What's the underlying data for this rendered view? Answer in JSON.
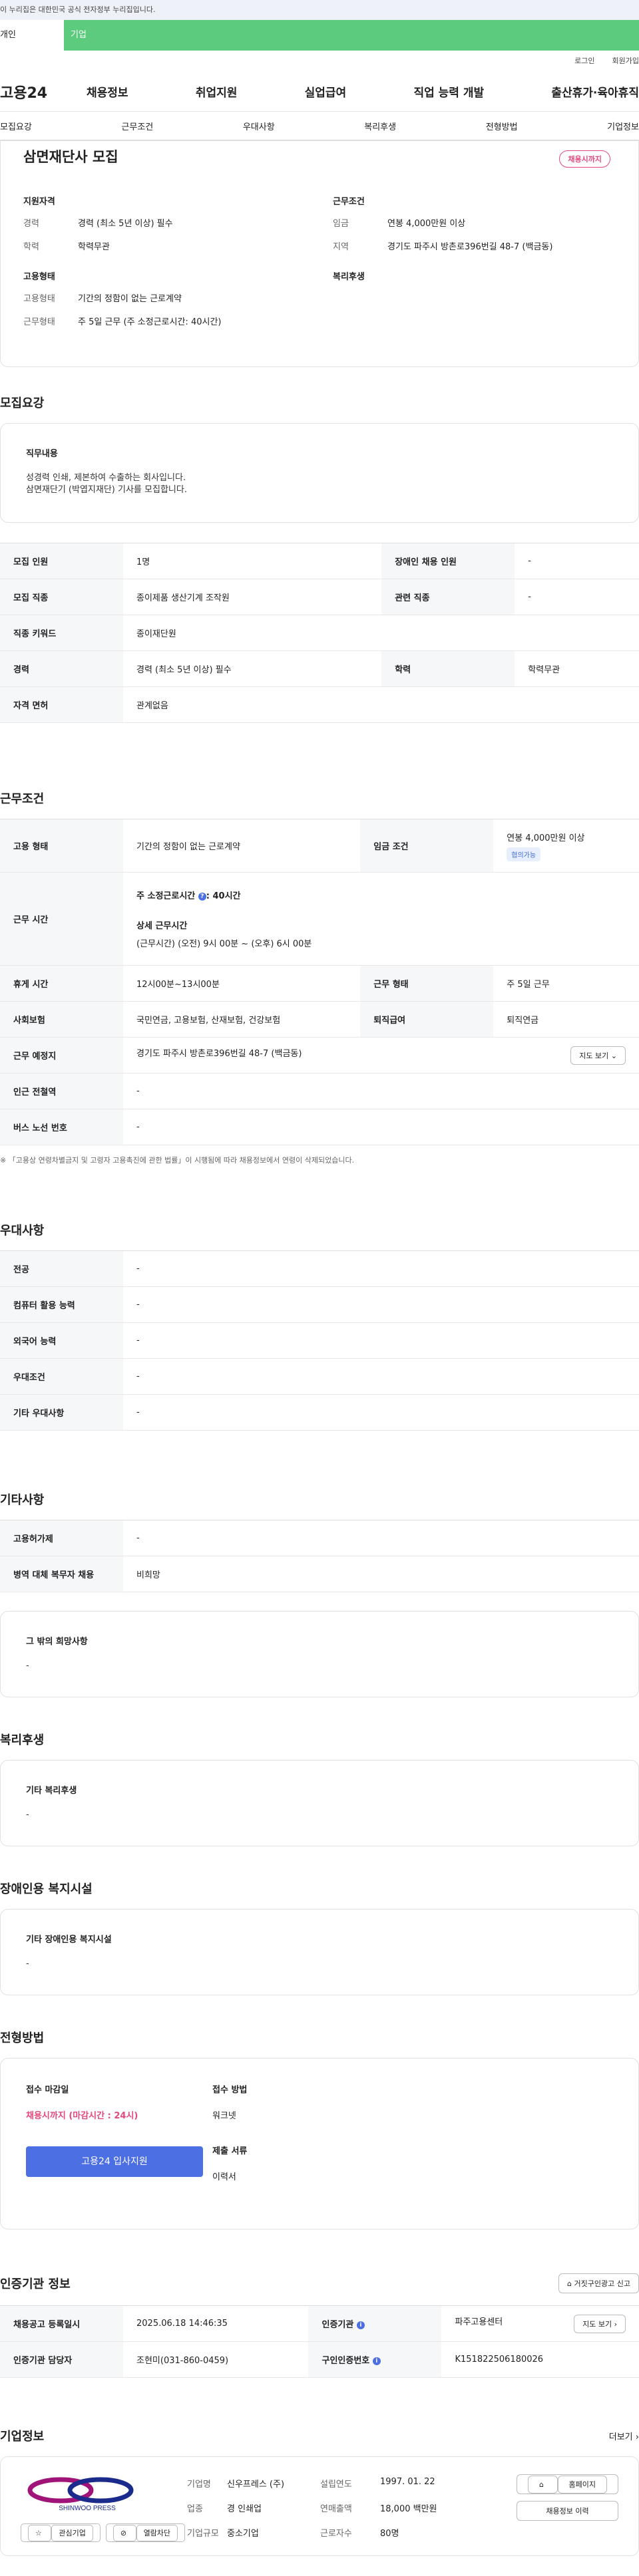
{
  "banner": "이 누리집은 대한민국 공식 전자정부 누리집입니다.",
  "user_tabs": {
    "personal": "개인",
    "enterprise": "기업"
  },
  "util": {
    "login": "로그인",
    "signup": "회원가입"
  },
  "gnb": {
    "logo": "고용24",
    "menu": [
      "채용정보",
      "취업지원",
      "실업급여",
      "직업 능력 개발",
      "출산휴가·육아휴직"
    ]
  },
  "subtabs": [
    "모집요강",
    "근무조건",
    "우대사항",
    "복리후생",
    "전형방법",
    "기업정보"
  ],
  "post": {
    "title": "삼면재단사 모집",
    "badge": "채용시까지",
    "qual_title": "지원자격",
    "qual": [
      {
        "k": "경력",
        "v": "경력 (최소 5년 이상) 필수"
      },
      {
        "k": "학력",
        "v": "학력무관"
      }
    ],
    "cond_title": "근무조건",
    "cond": [
      {
        "k": "임금",
        "v": "연봉 4,000만원 이상"
      },
      {
        "k": "지역",
        "v": "경기도 파주시 방촌로396번길 48-7 (백금동)"
      }
    ],
    "emp_title": "고용형태",
    "emp": [
      {
        "k": "고용형태",
        "v": "기간의 정함이 없는 근로계약"
      },
      {
        "k": "근무형태",
        "v": "주 5일 근무 (주 소정근로시간: 40시간)"
      }
    ],
    "welfare_title": "복리후생"
  },
  "recruit": {
    "title": "모집요강",
    "duty_title": "직무내용",
    "duty_lines": [
      "성경력 인쇄, 제본하여 수출하는 회사입니다.",
      "삼면재단기 (박엽지재단) 기사를 모집합니다."
    ],
    "rows": [
      [
        "모집 인원",
        "1명",
        "장애인 채용 인원",
        "-"
      ],
      [
        "모집 직종",
        "종이제품 생산기계 조작원",
        "관련 직종",
        "-"
      ],
      [
        "직종 키워드",
        "종이재단원"
      ],
      [
        "경력",
        "경력 (최소 5년 이상) 필수",
        "학력",
        "학력무관"
      ],
      [
        "자격 면허",
        "관계없음"
      ]
    ]
  },
  "work": {
    "title": "근무조건",
    "emp_type_k": "고용 형태",
    "emp_type_v": "기간의 정함이 없는 근로계약",
    "wage_k": "임금 조건",
    "wage_v": "연봉 4,000만원 이상",
    "wage_chip": "협의가능",
    "hours_k": "근무 시간",
    "hours_main": "주 소정근로시간",
    "hours_val": ": 40시간",
    "hours_sub": "상세 근무시간",
    "hours_detail": "(근무시간) (오전) 9시 00분 ~ (오후) 6시 00분",
    "rest_k": "휴게 시간",
    "rest_v": "12시00분~13시00분",
    "form_k": "근무 형태",
    "form_v": "주 5일 근무",
    "ins_k": "사회보험",
    "ins_v": "국민연금, 고용보험, 산재보험, 건강보험",
    "ret_k": "퇴직급여",
    "ret_v": "퇴직연금",
    "loc_k": "근무 예정지",
    "loc_v": "경기도 파주시 방촌로396번길 48-7 (백금동)",
    "map_btn": "지도 보기",
    "sub_k": "인근 전철역",
    "sub_v": "-",
    "bus_k": "버스 노선 번호",
    "bus_v": "-",
    "note": "※ 「고용상 연령차별금지 및 고령자 고용촉진에 관한 법률」이 시행됨에 따라 채용정보에서 연령이 삭제되었습니다."
  },
  "pref": {
    "title": "우대사항",
    "rows": [
      [
        "전공",
        "-"
      ],
      [
        "컴퓨터 활용 능력",
        "-"
      ],
      [
        "외국어 능력",
        "-"
      ],
      [
        "우대조건",
        "-"
      ],
      [
        "기타 우대사항",
        "-"
      ]
    ]
  },
  "etc": {
    "title": "기타사항",
    "rows": [
      [
        "고용허가제",
        "-"
      ],
      [
        "병역 대체 복무자 채용",
        "비희망"
      ]
    ],
    "hope_title": "그 밖의 희망사항",
    "hope_v": "-"
  },
  "welfare": {
    "title": "복리후생",
    "box_title": "기타 복리후생",
    "box_v": "-"
  },
  "disability": {
    "title": "장애인용 복지시설",
    "box_title": "기타 장애인용 복지시설",
    "box_v": "-"
  },
  "selection": {
    "title": "전형방법",
    "deadline_k": "접수 마감일",
    "deadline_v": "채용시까지 (마감시간 : 24시)",
    "method_k": "접수 방법",
    "method_v": "워크넷",
    "docs_k": "제출 서류",
    "docs_v": "이력서",
    "apply_btn": "고용24 입사지원"
  },
  "agency": {
    "title": "인증기관 정보",
    "report_btn": "거짓구인광고 신고",
    "date_k": "채용공고 등록일시",
    "date_v": "2025.06.18 14:46:35",
    "org_k": "인증기관",
    "org_v": "파주고용센터",
    "map_btn": "지도 보기",
    "mgr_k": "인증기관 담당자",
    "mgr_v": "조현미(031-860-0459)",
    "no_k": "구인인증번호",
    "no_v": "K151822506180026"
  },
  "company": {
    "title": "기업정보",
    "more": "더보기",
    "logo_text": "SHINWOO PRESS",
    "fav_btn": "관심기업",
    "block_btn": "열람차단",
    "fields": [
      [
        "기업명",
        "신우프레스 (주)",
        "설립연도",
        "1997. 01. 22"
      ],
      [
        "업종",
        "경 인쇄업",
        "연매출액",
        "18,000 백만원"
      ],
      [
        "기업규모",
        "중소기업",
        "근로자수",
        "80명"
      ]
    ],
    "homepage_btn": "홈페이지",
    "history_btn": "채용정보 이력"
  },
  "colors": {
    "accent_green": "#5ccb7d",
    "accent_blue": "#4d6fe4",
    "accent_pink": "#e5487a"
  }
}
